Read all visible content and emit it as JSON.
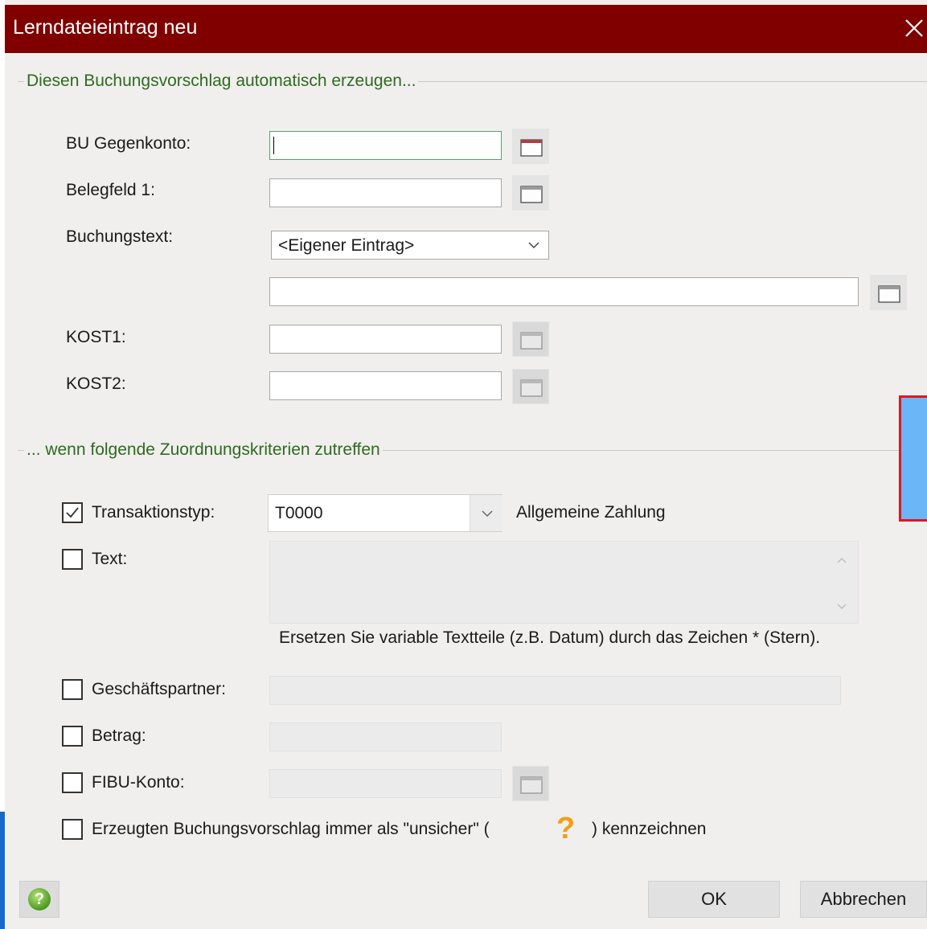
{
  "window": {
    "title": "Lerndateieintrag neu",
    "close_icon": "close-icon",
    "titlebar_color": "#800000"
  },
  "section1": {
    "legend": "Diesen Buchungsvorschlag automatisch erzeugen..."
  },
  "fields": {
    "bu_gegenkonto_label": "BU Gegenkonto:",
    "bu_gegenkonto_value": "",
    "belegfeld_label": "Belegfeld 1:",
    "belegfeld_value": "",
    "buchungstext_label": "Buchungstext:",
    "buchungstext_selected": "<Eigener Eintrag>",
    "buchungstext_value": "",
    "kost1_label": "KOST1:",
    "kost1_value": "",
    "kost2_label": "KOST2:",
    "kost2_value": ""
  },
  "section2": {
    "legend": "... wenn folgende Zuordnungskriterien zutreffen"
  },
  "criteria": {
    "transaktionstyp_label": "Transaktionstyp:",
    "transaktionstyp_checked": true,
    "transaktionstyp_value": "T0000",
    "transaktionstyp_desc": "Allgemeine Zahlung",
    "text_label": "Text:",
    "text_checked": false,
    "text_hint": "Ersetzen Sie variable Textteile (z.B. Datum) durch das Zeichen * (Stern).",
    "geschaeftspartner_label": "Geschäftspartner:",
    "geschaeftspartner_checked": false,
    "betrag_label": "Betrag:",
    "betrag_checked": false,
    "fibu_label": "FIBU-Konto:",
    "fibu_checked": false,
    "unsicher_prefix": "Erzeugten Buchungsvorschlag immer als \"unsicher\" (",
    "unsicher_icon": "?",
    "unsicher_suffix": ") kennzeichnen",
    "unsicher_checked": false
  },
  "buttons": {
    "help_icon": "help-icon",
    "ok": "OK",
    "cancel": "Abbrechen"
  }
}
